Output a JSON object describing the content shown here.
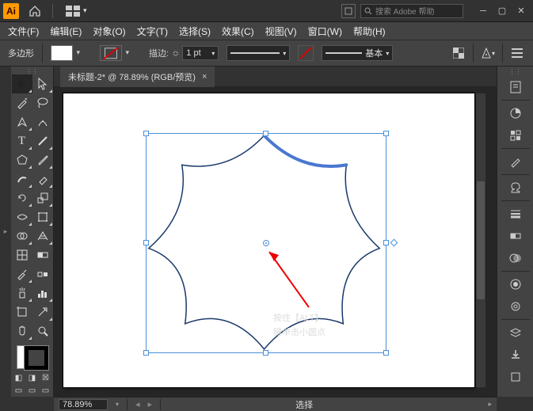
{
  "titlebar": {
    "logo": "Ai",
    "search_placeholder": "搜索 Adobe 帮助"
  },
  "menus": [
    "文件(F)",
    "编辑(E)",
    "对象(O)",
    "文字(T)",
    "选择(S)",
    "效果(C)",
    "视图(V)",
    "窗口(W)",
    "帮助(H)"
  ],
  "options": {
    "shape_label": "多边形",
    "stroke_label": "描边:",
    "stroke_value": "1 pt",
    "brush_label": "基本"
  },
  "doc": {
    "tab_title": "未标题-2* @ 78.89% (RGB/预览)"
  },
  "status": {
    "zoom": "78.89%",
    "selection": "选择"
  },
  "annotation": {
    "line1": "按住【ALT】",
    "line2": "键单击小圆点"
  }
}
